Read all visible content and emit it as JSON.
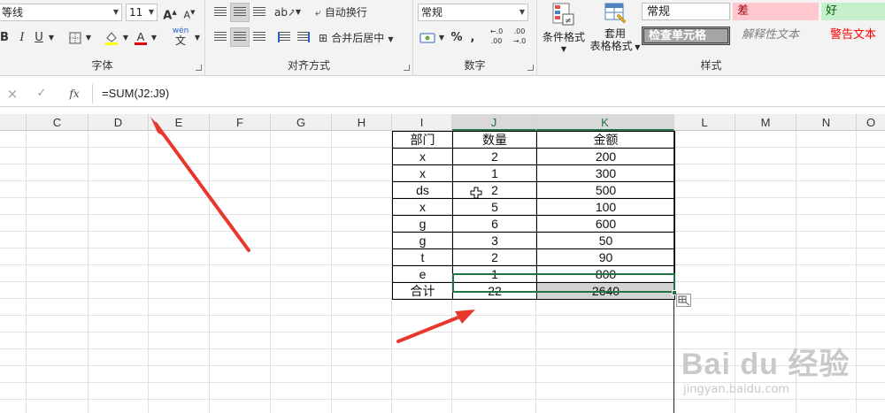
{
  "ribbon": {
    "font": {
      "font_name": "等线",
      "font_size": "11",
      "grow_label": "A",
      "shrink_label": "A",
      "bold": "B",
      "italic": "I",
      "underline": "U",
      "pinyin_top": "wén",
      "pinyin_bottom": "文",
      "group_label": "字体"
    },
    "alignment": {
      "wrap_text": "自动换行",
      "merge_center": "合并后居中",
      "group_label": "对齐方式"
    },
    "number": {
      "format": "常规",
      "percent": "%",
      "comma": ",",
      "dec_increase": "←.0 .00",
      "dec_decrease": ".00 →.0",
      "group_label": "数字"
    },
    "styles": {
      "cond_format": "条件格式",
      "table_format_line1": "套用",
      "table_format_line2": "表格格式",
      "normal": "常规",
      "bad": "差",
      "good": "好",
      "check_cell": "检查单元格",
      "explanatory": "解释性文本",
      "warning": "警告文本",
      "group_label": "样式"
    }
  },
  "formula_bar": {
    "cancel": "×",
    "confirm": "✓",
    "fx": "fx",
    "formula": "=SUM(J2:J9)"
  },
  "columns": [
    "C",
    "D",
    "E",
    "F",
    "G",
    "H",
    "I",
    "J",
    "K",
    "L",
    "M",
    "N",
    "O"
  ],
  "sheet": {
    "header": [
      "部门",
      "数量",
      "金额"
    ],
    "rows": [
      [
        "x",
        "2",
        "200"
      ],
      [
        "x",
        "1",
        "300"
      ],
      [
        "ds",
        "2",
        "500"
      ],
      [
        "x",
        "5",
        "100"
      ],
      [
        "g",
        "6",
        "600"
      ],
      [
        "g",
        "3",
        "50"
      ],
      [
        "t",
        "2",
        "90"
      ],
      [
        "e",
        "1",
        "800"
      ]
    ],
    "total": [
      "合计",
      "22",
      "2640"
    ]
  },
  "watermark": {
    "brand": "Bai du 经验",
    "url": "jingyan.baidu.com"
  },
  "colors": {
    "accent": "#217346",
    "arrow": "#e8372c",
    "bad_bg": "#ffc7ce",
    "bad_text": "#9c0006",
    "good_bg": "#c6efce",
    "good_text": "#006100",
    "warning_text": "#ff0000"
  }
}
